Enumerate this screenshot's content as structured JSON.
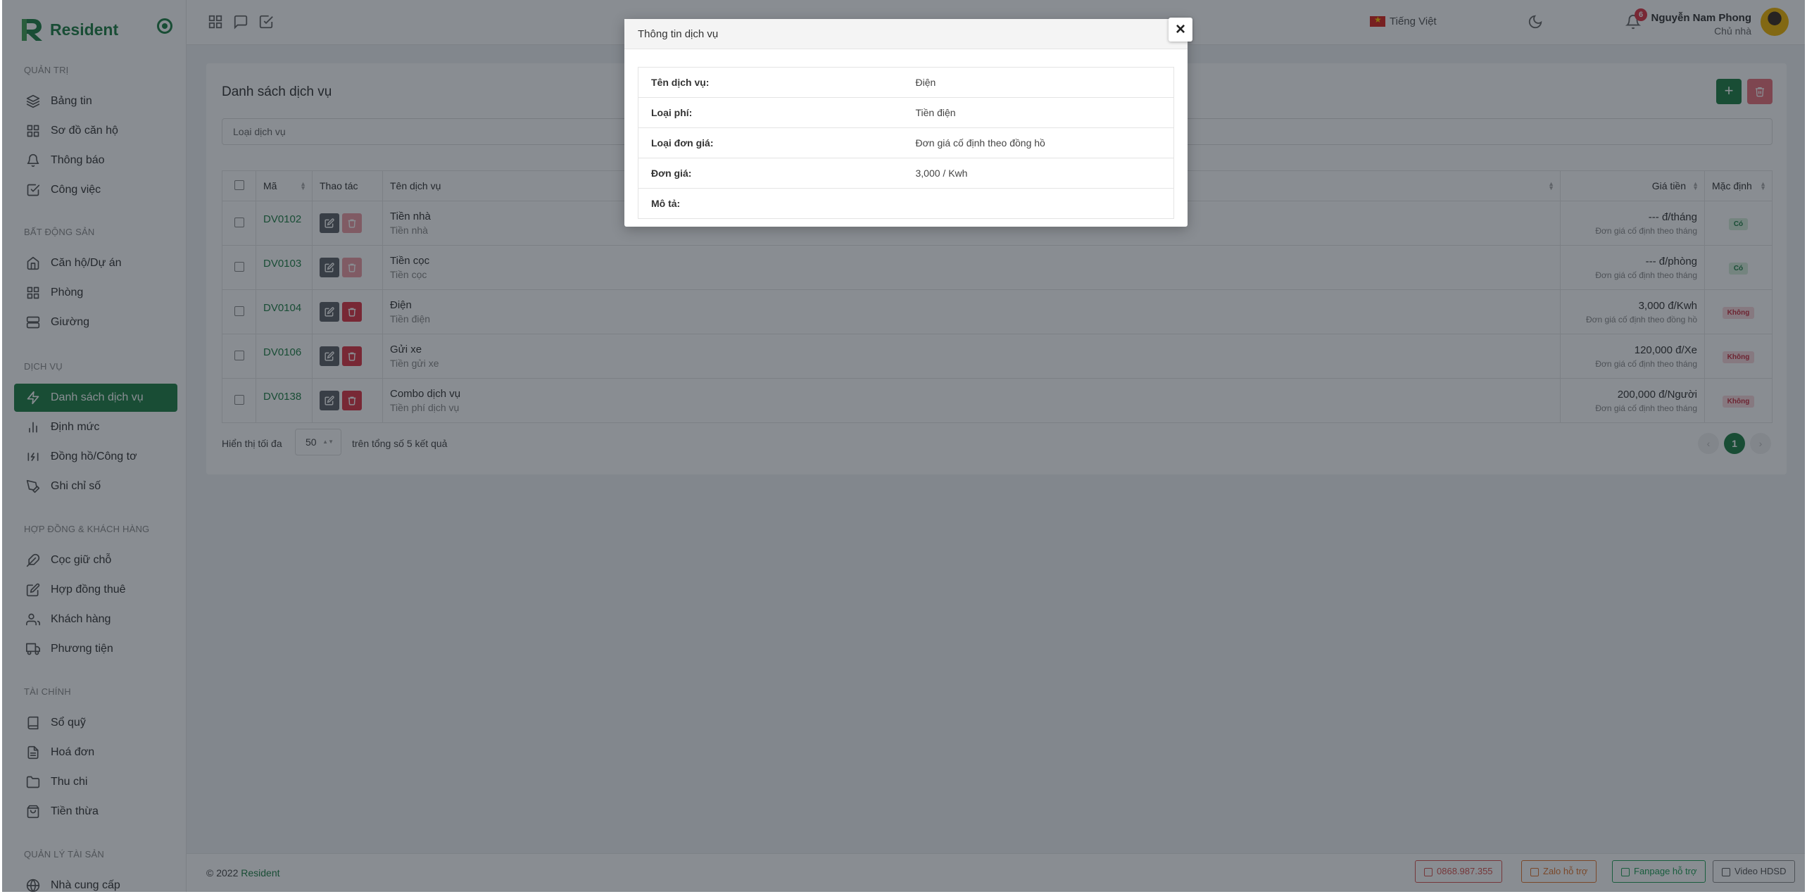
{
  "brand": {
    "name": "Resident"
  },
  "sidebar": {
    "sections": [
      {
        "label": "QUẢN TRỊ",
        "items": [
          {
            "label": "Bảng tin",
            "icon": "layers-icon"
          },
          {
            "label": "Sơ đồ căn hộ",
            "icon": "grid-icon"
          },
          {
            "label": "Thông báo",
            "icon": "bell-icon"
          },
          {
            "label": "Công việc",
            "icon": "check-square-icon"
          }
        ]
      },
      {
        "label": "BẤT ĐỘNG SẢN",
        "items": [
          {
            "label": "Căn hộ/Dự án",
            "icon": "home-icon"
          },
          {
            "label": "Phòng",
            "icon": "grid-icon"
          },
          {
            "label": "Giường",
            "icon": "server-icon"
          }
        ]
      },
      {
        "label": "DỊCH VỤ",
        "items": [
          {
            "label": "Danh sách dịch vụ",
            "icon": "zap-icon",
            "active": true
          },
          {
            "label": "Định mức",
            "icon": "bar-chart-icon"
          },
          {
            "label": "Đồng hồ/Công tơ",
            "icon": "meter-icon"
          },
          {
            "label": "Ghi chỉ số",
            "icon": "pen-tool-icon"
          }
        ]
      },
      {
        "label": "HỢP ĐỒNG & KHÁCH HÀNG",
        "items": [
          {
            "label": "Cọc giữ chỗ",
            "icon": "feather-icon"
          },
          {
            "label": "Hợp đồng thuê",
            "icon": "edit-icon"
          },
          {
            "label": "Khách hàng",
            "icon": "users-icon"
          },
          {
            "label": "Phương tiện",
            "icon": "truck-icon"
          }
        ]
      },
      {
        "label": "TÀI CHÍNH",
        "items": [
          {
            "label": "Sổ quỹ",
            "icon": "book-icon"
          },
          {
            "label": "Hoá đơn",
            "icon": "file-text-icon"
          },
          {
            "label": "Thu chi",
            "icon": "folder-icon"
          },
          {
            "label": "Tiền thừa",
            "icon": "shopping-bag-icon"
          }
        ]
      },
      {
        "label": "QUẢN LÝ TÀI SẢN",
        "items": [
          {
            "label": "Nhà cung cấp",
            "icon": "globe-icon"
          }
        ]
      }
    ]
  },
  "topbar": {
    "language": "Tiếng Việt",
    "notification_count": "6",
    "user_name": "Nguyễn Nam Phong",
    "user_role": "Chủ nhà"
  },
  "page": {
    "title": "Danh sách dịch vụ",
    "add_label": "+",
    "filter_placeholder": "Loại dịch vụ",
    "columns": [
      "Mã",
      "Thao tác",
      "Tên dịch vụ",
      "Giá tiền",
      "Mặc định"
    ],
    "rows": [
      {
        "code": "DV0102",
        "name": "Tiền nhà",
        "type": "Tiền nhà",
        "price": "--- đ/tháng",
        "price_type": "Đơn giá cố định theo tháng",
        "default": "Có",
        "deletable": false
      },
      {
        "code": "DV0103",
        "name": "Tiền cọc",
        "type": "Tiền cọc",
        "price": "--- đ/phòng",
        "price_type": "Đơn giá cố định theo tháng",
        "default": "Có",
        "deletable": false
      },
      {
        "code": "DV0104",
        "name": "Điện",
        "type": "Tiền điện",
        "price": "3,000 đ/Kwh",
        "price_type": "Đơn giá cố định theo đồng hồ",
        "default": "Không",
        "deletable": true
      },
      {
        "code": "DV0106",
        "name": "Gửi xe",
        "type": "Tiền gửi xe",
        "price": "120,000 đ/Xe",
        "price_type": "Đơn giá cố định theo tháng",
        "default": "Không",
        "deletable": true
      },
      {
        "code": "DV0138",
        "name": "Combo dịch vụ",
        "type": "Tiền phí dịch vụ",
        "price": "200,000 đ/Người",
        "price_type": "Đơn giá cố định theo tháng",
        "default": "Không",
        "deletable": true
      }
    ],
    "show_max_label": "Hiển thị tối đa",
    "page_size": "50",
    "total_label": "trên tổng số 5 kết quả",
    "current_page": "1"
  },
  "footer": {
    "year": "© 2022",
    "brand": "Resident",
    "phone": "0868.987.355",
    "zalo": "Zalo hỗ trợ",
    "fanpage": "Fanpage hỗ trợ",
    "video": "Video HDSD"
  },
  "modal": {
    "title": "Thông tin dịch vụ",
    "close": "×",
    "fields": [
      {
        "label": "Tên dịch vụ:",
        "value": "Điện"
      },
      {
        "label": "Loại phí:",
        "value": "Tiền điện"
      },
      {
        "label": "Loại đơn giá:",
        "value": "Đơn giá cố định theo đồng hồ"
      },
      {
        "label": "Đơn giá:",
        "value": "3,000 / Kwh"
      },
      {
        "label": "Mô tả:",
        "value": ""
      }
    ]
  },
  "colors": {
    "brand": "#1e7e45",
    "danger": "#dc3545",
    "overlay": "rgba(20,28,38,0.5)"
  }
}
